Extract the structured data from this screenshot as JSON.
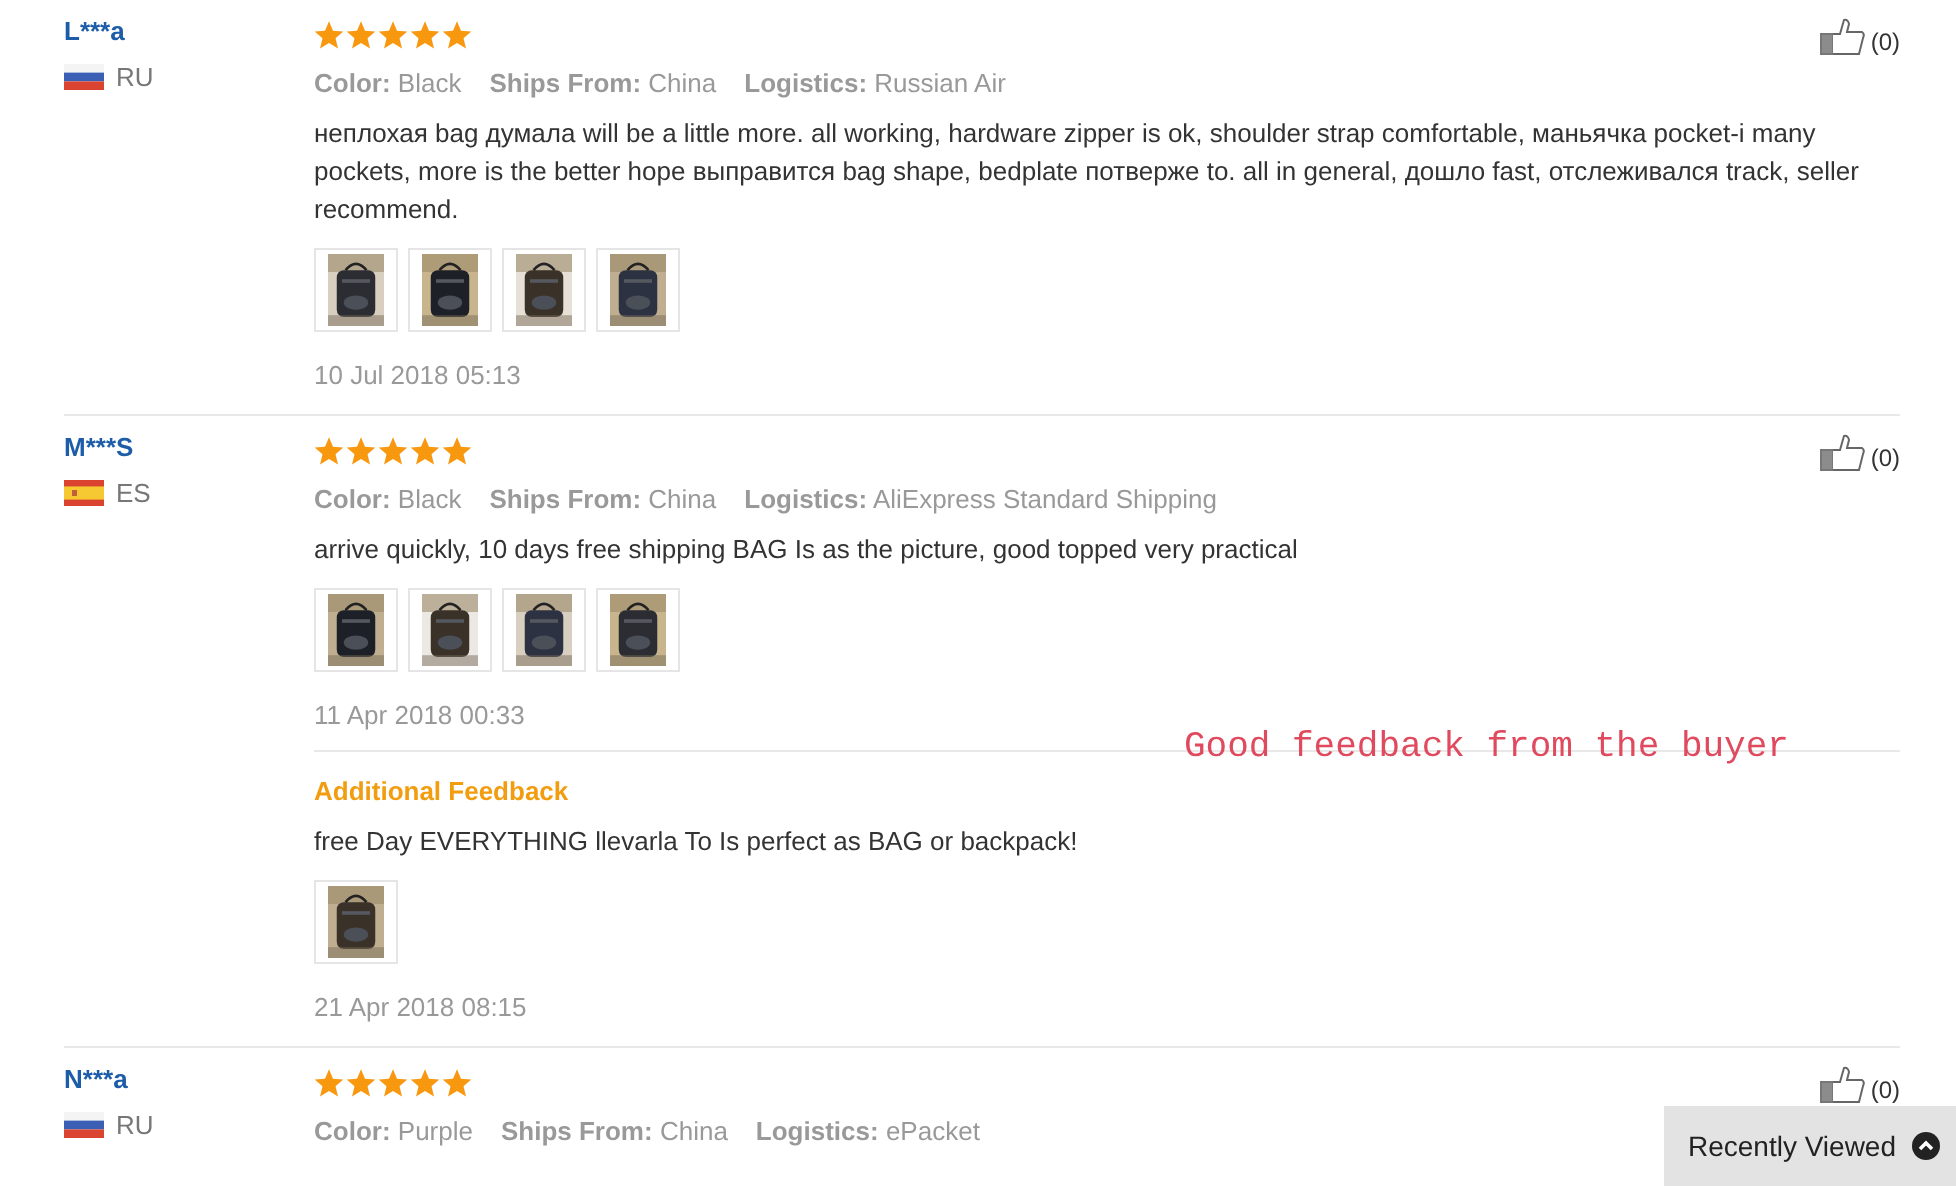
{
  "reviews": [
    {
      "user": "L***a",
      "flag": {
        "kind": "ru"
      },
      "country": "RU",
      "stars": 5,
      "attributes": [
        {
          "label": "Color:",
          "value": "Black"
        },
        {
          "label": "Ships From:",
          "value": "China"
        },
        {
          "label": "Logistics:",
          "value": "Russian Air"
        }
      ],
      "text": "неплохая bag думала will be a little more. all working, hardware zipper is ok, shoulder strap comfortable, маньячка pocket-i many pockets, more is the better hope выправится bag shape, bedplate потверже to. all in general, дошло fast, отслеживался track, seller recommend.",
      "photos": [
        {
          "kind": "picture"
        },
        {
          "kind": "picture"
        },
        {
          "kind": "picture"
        },
        {
          "kind": "picture"
        }
      ],
      "date": "10 Jul 2018 05:13",
      "likes": "(0)"
    },
    {
      "user": "M***S",
      "flag": {
        "kind": "es"
      },
      "country": "ES",
      "stars": 5,
      "attributes": [
        {
          "label": "Color:",
          "value": "Black"
        },
        {
          "label": "Ships From:",
          "value": "China"
        },
        {
          "label": "Logistics:",
          "value": "AliExpress Standard Shipping"
        }
      ],
      "text": "arrive quickly, 10 days free shipping BAG Is as the picture, good topped very practical",
      "photos": [
        {
          "kind": "picture"
        },
        {
          "kind": "picture"
        },
        {
          "kind": "picture"
        },
        {
          "kind": "picture"
        }
      ],
      "date": "11 Apr 2018 00:33",
      "likes": "(0)",
      "additional": {
        "title": "Additional Feedback",
        "text": "free Day EVERYTHING llevarla To Is perfect as BAG or backpack!",
        "photos": [
          {
            "kind": "picture"
          }
        ],
        "date": "21 Apr 2018 08:15"
      }
    },
    {
      "user": "N***a",
      "flag": {
        "kind": "ru"
      },
      "country": "RU",
      "stars": 5,
      "attributes": [
        {
          "label": "Color:",
          "value": "Purple"
        },
        {
          "label": "Ships From:",
          "value": "China"
        },
        {
          "label": "Logistics:",
          "value": "ePacket"
        }
      ],
      "likes": "(0)"
    }
  ],
  "annotation": "Good feedback from the buyer",
  "recently_viewed": {
    "label": "Recently Viewed",
    "expanded": false
  }
}
